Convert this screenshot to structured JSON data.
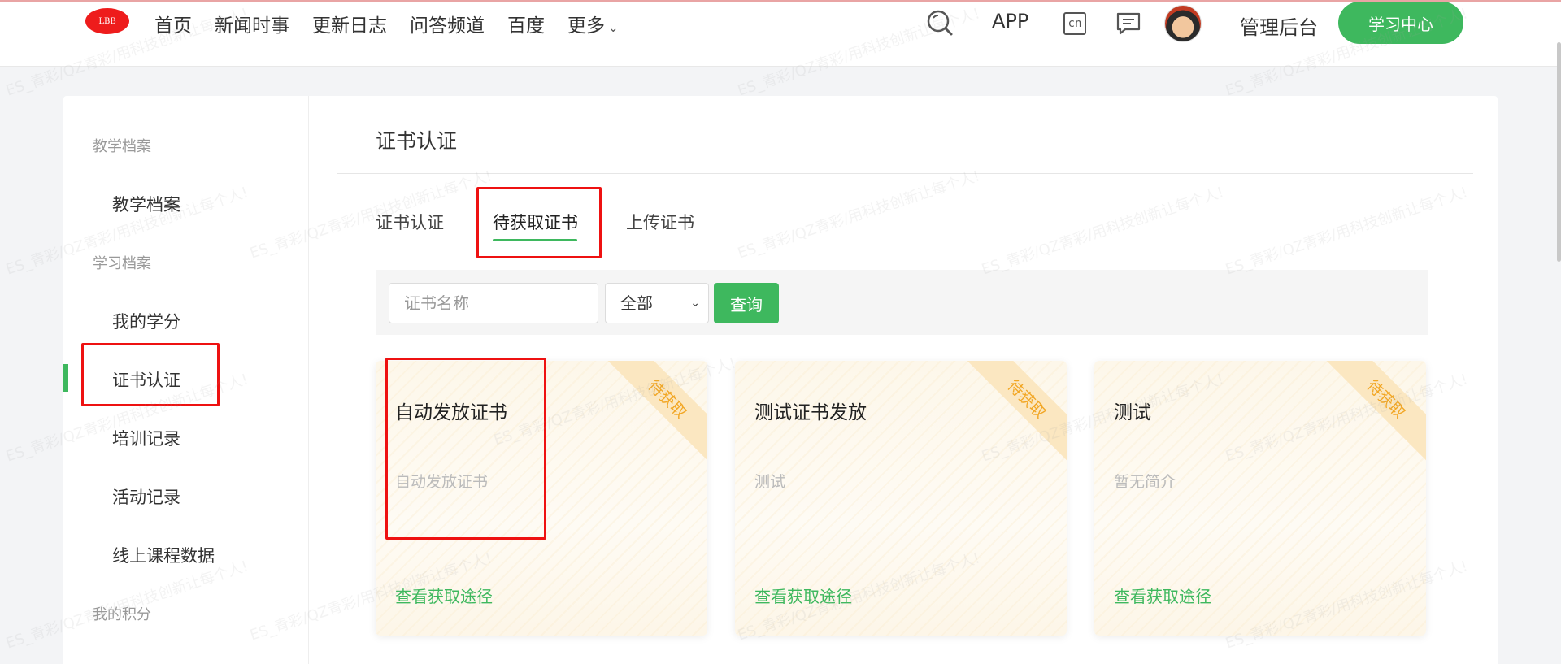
{
  "header": {
    "logo_text": "LBB",
    "nav": [
      {
        "label": "首页"
      },
      {
        "label": "新闻时事"
      },
      {
        "label": "更新日志"
      },
      {
        "label": "问答频道"
      },
      {
        "label": "百度"
      },
      {
        "label": "更多"
      }
    ],
    "app_label": "APP",
    "cn_label": "cn",
    "admin_label": "管理后台",
    "learn_center_label": "学习中心"
  },
  "sidebar": {
    "groups": [
      {
        "title": "教学档案",
        "items": [
          "教学档案"
        ]
      },
      {
        "title": "学习档案",
        "items": [
          "我的学分",
          "证书认证",
          "培训记录",
          "活动记录",
          "线上课程数据"
        ]
      },
      {
        "title": "我的积分",
        "items": []
      }
    ],
    "active_item": "证书认证"
  },
  "main": {
    "title": "证书认证",
    "tabs": [
      {
        "label": "证书认证",
        "active": false
      },
      {
        "label": "待获取证书",
        "active": true
      },
      {
        "label": "上传证书",
        "active": false
      }
    ],
    "filter": {
      "search_placeholder": "证书名称",
      "select_value": "全部",
      "query_label": "查询"
    },
    "cards": [
      {
        "ribbon": "待获取",
        "title": "自动发放证书",
        "desc": "自动发放证书",
        "link": "查看获取途径"
      },
      {
        "ribbon": "待获取",
        "title": "测试证书发放",
        "desc": "测试",
        "link": "查看获取途径"
      },
      {
        "ribbon": "待获取",
        "title": "测试",
        "desc": "暂无简介",
        "link": "查看获取途径"
      }
    ]
  },
  "colors": {
    "accent": "#3eb85e",
    "ribbon_text": "#f2a623",
    "highlight_box": "#ee1111"
  },
  "watermark_text": "ES_青彩/QZ青彩/用科技创新让每个人!"
}
